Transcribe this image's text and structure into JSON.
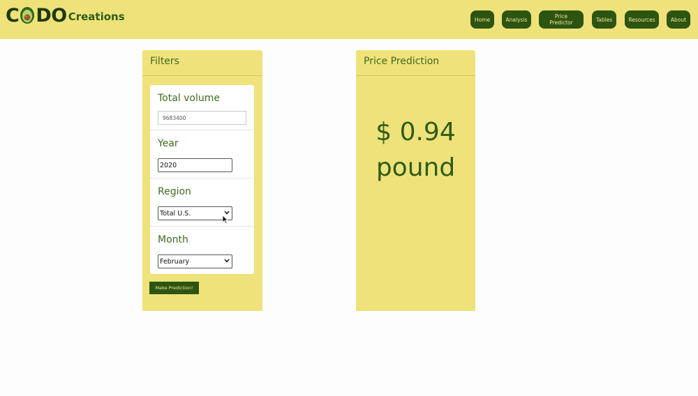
{
  "brand": {
    "logo_prefix": "C",
    "logo_suffix": "DO",
    "logo_word": "Creations",
    "logo_icon": "avocado-icon"
  },
  "nav": {
    "items": [
      {
        "label": "Home"
      },
      {
        "label": "Analysis"
      },
      {
        "label": "Price Predictor"
      },
      {
        "label": "Tables"
      },
      {
        "label": "Resources"
      },
      {
        "label": "About"
      }
    ]
  },
  "filters": {
    "title": "Filters",
    "total_volume": {
      "label": "Total volume",
      "placeholder": "9683400"
    },
    "year": {
      "label": "Year",
      "value": "2020"
    },
    "region": {
      "label": "Region",
      "selected": "Total U.S."
    },
    "month": {
      "label": "Month",
      "selected": "February"
    },
    "submit_label": "Make Prediction!"
  },
  "prediction": {
    "title": "Price Prediction",
    "price": "$ 0.94",
    "unit": "pound"
  },
  "colors": {
    "accent_yellow": "#efe27a",
    "dark_green": "#2d5410",
    "label_green": "#3e6b1c"
  }
}
